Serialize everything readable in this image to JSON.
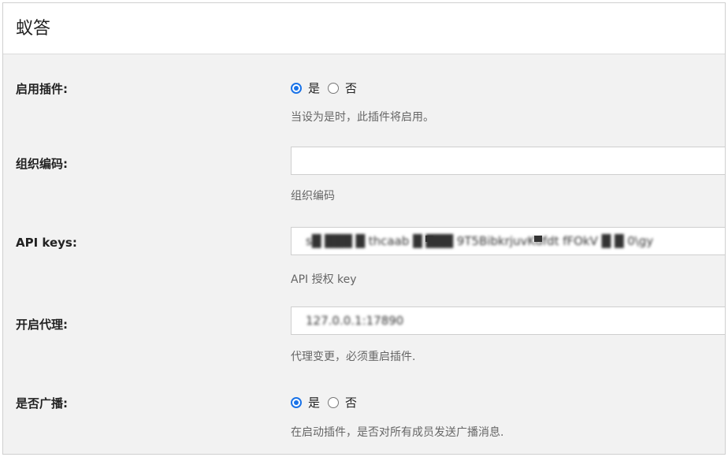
{
  "panel": {
    "title": "蚁答"
  },
  "enable_plugin": {
    "label": "启用插件:",
    "options": [
      {
        "label": "是",
        "checked": true
      },
      {
        "label": "否",
        "checked": false
      }
    ],
    "description": "当设为是时，此插件将启用。"
  },
  "org_code": {
    "label": "组织编码:",
    "value": "",
    "description": "组织编码"
  },
  "api_keys": {
    "label": "API keys:",
    "value": "s█ ███ █ thcaab █  ███ 9T5BibkrjuvKdfdt fFOkV █ █ 0\\gy",
    "description": "API 授权 key"
  },
  "proxy": {
    "label": "开启代理:",
    "value": "127.0.0.1:17890",
    "description": "代理变更，必须重启插件."
  },
  "broadcast": {
    "label": "是否广播:",
    "options": [
      {
        "label": "是",
        "checked": true
      },
      {
        "label": "否",
        "checked": false
      }
    ],
    "description": "在启动插件，是否对所有成员发送广播消息."
  },
  "colors": {
    "accent": "#1a73e8",
    "background": "#f2f2f2",
    "field": "#ffffff"
  }
}
